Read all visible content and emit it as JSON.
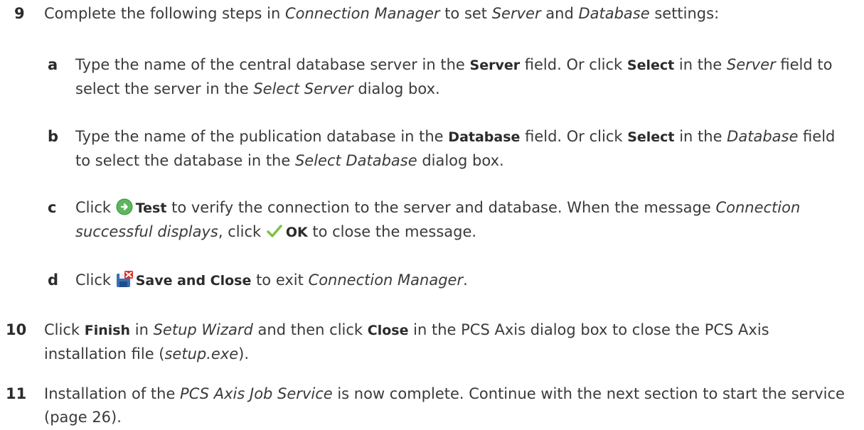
{
  "step9": {
    "number": "9",
    "intro_a": "Complete the following steps in ",
    "intro_app": "Connection Manager",
    "intro_b": " to set ",
    "intro_server": "Server",
    "intro_c": " and ",
    "intro_database": "Database",
    "intro_d": " settings:",
    "substeps": {
      "a": {
        "letter": "a",
        "t1": "Type the name of the central database server in the ",
        "server_label": "Server",
        "t2": " field. Or click ",
        "select_label": "Select",
        "t3": " in the ",
        "server_field": "Server",
        "t4": " field to select the server in the ",
        "dialog": "Select Server",
        "t5": " dialog box."
      },
      "b": {
        "letter": "b",
        "t1": "Type the name of the publication database in the ",
        "database_label": "Database",
        "t2": " field. Or click ",
        "select_label": "Select",
        "t3": " in the ",
        "database_field": "Database",
        "t4": " field to select the database in the ",
        "dialog": "Select Database",
        "t5": " dialog box."
      },
      "c": {
        "letter": "c",
        "t1": "Click ",
        "test_icon": "green-arrow-circle-icon",
        "test_label": "Test",
        "t2": " to verify the connection to the server and database. When the message ",
        "message": "Connection successful displays",
        "t3": ", click ",
        "ok_icon": "checkmark-icon",
        "ok_label": "OK",
        "t4": " to close the message."
      },
      "d": {
        "letter": "d",
        "t1": "Click ",
        "save_icon": "save-and-close-icon",
        "save_label": "Save and Close",
        "t2": " to exit ",
        "app": "Connection Manager",
        "t3": "."
      }
    }
  },
  "step10": {
    "number": "10",
    "t1": "Click ",
    "finish_label": "Finish",
    "t2": " in ",
    "wizard": "Setup Wizard",
    "t3": " and then click ",
    "close_label": "Close",
    "t4": " in the PCS Axis dialog box to close the PCS Axis installation file (",
    "file": "setup.exe",
    "t5": ")."
  },
  "step11": {
    "number": "11",
    "t1": "Installation of the ",
    "service": "PCS Axis Job Service",
    "t2": " is now complete. Continue with the next section to start the service (page 26)."
  },
  "colors": {
    "text": "#3a3a3a",
    "test_icon_green": "#5cb85c",
    "ok_check_green": "#7cc242",
    "save_icon_blue": "#3a6fb0",
    "save_icon_red": "#d9322b"
  }
}
